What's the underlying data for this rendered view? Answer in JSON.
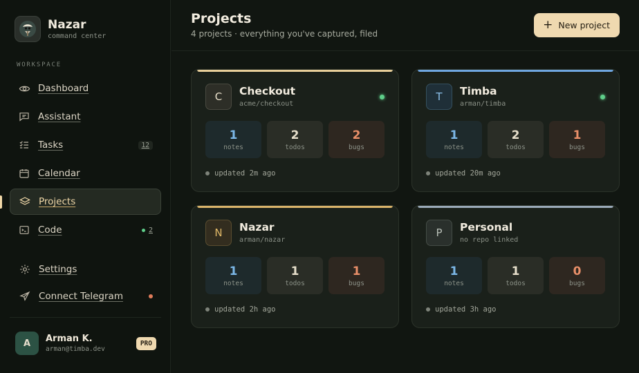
{
  "brand": {
    "name": "Nazar",
    "subtitle": "command center"
  },
  "sidebar": {
    "section_label": "WORKSPACE",
    "items": [
      {
        "label": "Dashboard",
        "icon": "eye-icon"
      },
      {
        "label": "Assistant",
        "icon": "chat-icon"
      },
      {
        "label": "Tasks",
        "icon": "tasks-icon",
        "badge": "12"
      },
      {
        "label": "Calendar",
        "icon": "calendar-icon"
      },
      {
        "label": "Projects",
        "icon": "layers-icon",
        "active": true
      },
      {
        "label": "Code",
        "icon": "terminal-icon",
        "badge": "2",
        "badge_status": "online"
      }
    ],
    "secondary": [
      {
        "label": "Settings",
        "icon": "gear-icon"
      },
      {
        "label": "Connect Telegram",
        "icon": "send-icon"
      }
    ]
  },
  "user": {
    "initial": "A",
    "name": "Arman K.",
    "email": "arman@timba.dev",
    "plan": "PRO"
  },
  "header": {
    "title": "Projects",
    "subtitle": "4 projects · everything you've captured, filed",
    "new_button": "New project"
  },
  "projects": [
    {
      "letter": "C",
      "name": "Checkout",
      "repo": "acme/checkout",
      "accent": "#e8cf9a",
      "active": true,
      "notes": "1",
      "todos": "2",
      "bugs": "2",
      "updated": "updated 2m ago"
    },
    {
      "letter": "T",
      "name": "Timba",
      "repo": "arman/timba",
      "accent": "#6fa6e0",
      "active": true,
      "notes": "1",
      "todos": "2",
      "bugs": "1",
      "updated": "updated 20m ago"
    },
    {
      "letter": "N",
      "name": "Nazar",
      "repo": "arman/nazar",
      "accent": "#d9b36a",
      "active": false,
      "notes": "1",
      "todos": "1",
      "bugs": "1",
      "updated": "updated 2h ago"
    },
    {
      "letter": "P",
      "name": "Personal",
      "repo": "no repo linked",
      "accent": "#9aa9b8",
      "active": false,
      "notes": "1",
      "todos": "1",
      "bugs": "0",
      "updated": "updated 3h ago"
    }
  ],
  "stat_labels": {
    "notes": "notes",
    "todos": "todos",
    "bugs": "bugs"
  },
  "colors": {
    "accent": "#efd9b0",
    "background": "#111611",
    "online": "#5fce8a",
    "alert": "#e07c5a"
  }
}
